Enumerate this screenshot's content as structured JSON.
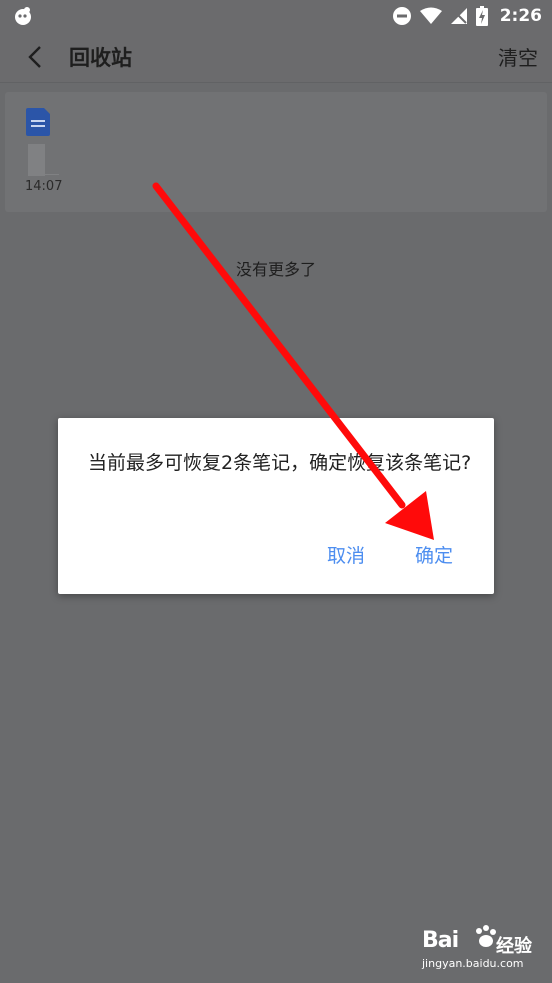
{
  "status_bar": {
    "time": "2:26",
    "icons": [
      "app-notification-icon",
      "do-not-disturb-icon",
      "wifi-icon",
      "signal-no-sim-icon",
      "battery-charging-icon"
    ]
  },
  "app_bar": {
    "back_icon": "chevron-left-icon",
    "title": "回收站",
    "clear_label": "清空"
  },
  "note": {
    "icon": "document-icon",
    "time": "14:07"
  },
  "list_footer": "没有更多了",
  "dialog": {
    "message": "当前最多可恢复2条笔记，确定恢复该条笔记?",
    "cancel_label": "取消",
    "confirm_label": "确定",
    "accent_color": "#4d8ef0"
  },
  "overlay": {
    "arrow_color": "#ff0a0a"
  },
  "watermark": {
    "logo": "Bai",
    "brand": "经验",
    "url": "jingyan.baidu.com"
  }
}
